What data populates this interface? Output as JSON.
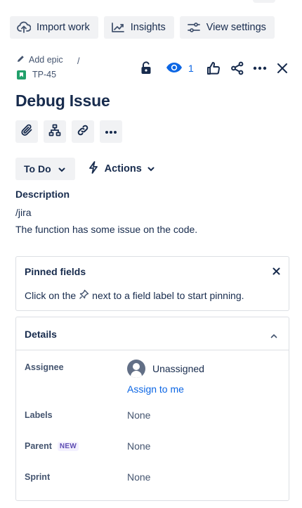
{
  "toolbar": {
    "import_label": "Import work",
    "insights_label": "Insights",
    "view_settings_label": "View settings"
  },
  "breadcrumb": {
    "epic_label": "Add epic",
    "separator": "/",
    "issue_key": "TP-45"
  },
  "header": {
    "watch_count": "1"
  },
  "issue": {
    "title": "Debug Issue"
  },
  "status": {
    "current": "To Do",
    "actions_label": "Actions"
  },
  "description": {
    "label": "Description",
    "line1": "/jira",
    "line2": "The function has some issue on the code."
  },
  "pinned": {
    "title": "Pinned fields",
    "text_before": "Click on the",
    "text_after": "next to a field label to start pinning."
  },
  "details": {
    "title": "Details",
    "assignee_label": "Assignee",
    "assignee_value": "Unassigned",
    "assign_to_me": "Assign to me",
    "labels_label": "Labels",
    "labels_value": "None",
    "parent_label": "Parent",
    "parent_badge": "NEW",
    "parent_value": "None",
    "sprint_label": "Sprint",
    "sprint_value": "None"
  },
  "colors": {
    "accent": "#0c66e4",
    "story": "#22a06b",
    "button_bg": "#f1f2f4",
    "text": "#172b4d",
    "subtle_text": "#44546f",
    "new_badge": "#5e4db2"
  },
  "icons": {
    "toolbar": [
      "cloud-upload-icon",
      "trend-line-icon",
      "sliders-icon"
    ],
    "header": [
      "unlock-icon",
      "eye-icon",
      "thumbs-up-icon",
      "share-icon",
      "more-icon",
      "close-icon"
    ],
    "quick": [
      "paperclip-icon",
      "child-issues-icon",
      "link-icon",
      "more-icon"
    ]
  }
}
